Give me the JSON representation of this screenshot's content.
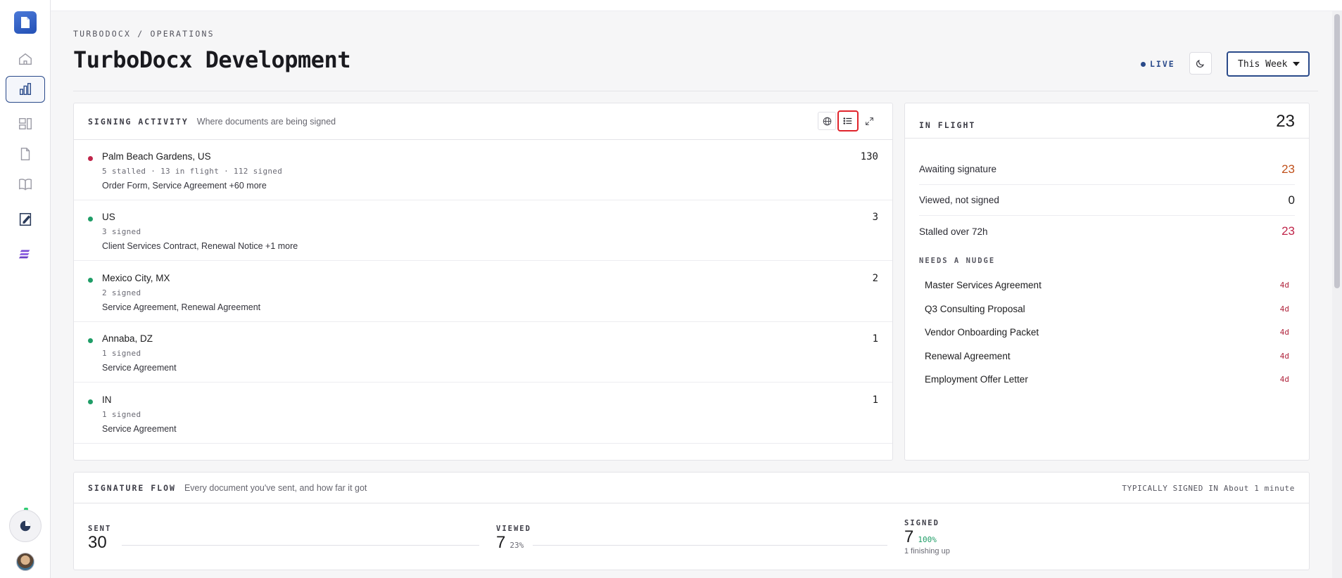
{
  "breadcrumb": "TURBODOCX / OPERATIONS",
  "page_title": "TurboDocx Development",
  "live_label": "LIVE",
  "range_select": {
    "value": "This Week"
  },
  "sidebar": {
    "items": [
      {
        "icon": "home-icon"
      },
      {
        "icon": "bar-chart-icon",
        "active": true
      },
      {
        "icon": "dashboard-icon"
      },
      {
        "icon": "document-icon"
      },
      {
        "icon": "book-icon"
      },
      {
        "icon": "edit-document-icon"
      },
      {
        "icon": "brand-stack-icon"
      }
    ]
  },
  "activity": {
    "label": "SIGNING ACTIVITY",
    "subtitle": "Where documents are being signed",
    "rows": [
      {
        "place": "Palm Beach Gardens, US",
        "stats": "5 stalled · 13 in flight · 112 signed",
        "docs": "Order Form, Service Agreement +60 more",
        "count": "130",
        "color": "#c0254a"
      },
      {
        "place": "US",
        "stats": "3 signed",
        "docs": "Client Services Contract, Renewal Notice +1 more",
        "count": "3",
        "color": "#1f9d67"
      },
      {
        "place": "Mexico City, MX",
        "stats": "2 signed",
        "docs": "Service Agreement, Renewal Agreement",
        "count": "2",
        "color": "#1f9d67"
      },
      {
        "place": "Annaba, DZ",
        "stats": "1 signed",
        "docs": "Service Agreement",
        "count": "1",
        "color": "#1f9d67"
      },
      {
        "place": "IN",
        "stats": "1 signed",
        "docs": "Service Agreement",
        "count": "1",
        "color": "#1f9d67"
      }
    ]
  },
  "inflight": {
    "label": "IN FLIGHT",
    "total": "23",
    "metrics": [
      {
        "label": "Awaiting signature",
        "value": "23",
        "color": "#c0501a"
      },
      {
        "label": "Viewed, not signed",
        "value": "0",
        "color": "#1c1c1e"
      },
      {
        "label": "Stalled over 72h",
        "value": "23",
        "color": "#c0254a"
      }
    ],
    "nudge_label": "NEEDS A NUDGE",
    "nudges": [
      {
        "title": "Master Services Agreement",
        "age": "4d"
      },
      {
        "title": "Q3 Consulting Proposal",
        "age": "4d"
      },
      {
        "title": "Vendor Onboarding Packet",
        "age": "4d"
      },
      {
        "title": "Renewal Agreement",
        "age": "4d"
      },
      {
        "title": "Employment Offer Letter",
        "age": "4d"
      }
    ]
  },
  "flow": {
    "label": "SIGNATURE FLOW",
    "subtitle": "Every document you've sent, and how far it got",
    "typical": "TYPICALLY SIGNED IN About 1 minute",
    "stages": [
      {
        "label": "SENT",
        "value": "30",
        "pct": "",
        "note": ""
      },
      {
        "label": "VIEWED",
        "value": "7",
        "pct": "23%",
        "note": ""
      },
      {
        "label": "SIGNED",
        "value": "7",
        "pct": "100%",
        "note": "1 finishing up"
      }
    ]
  }
}
